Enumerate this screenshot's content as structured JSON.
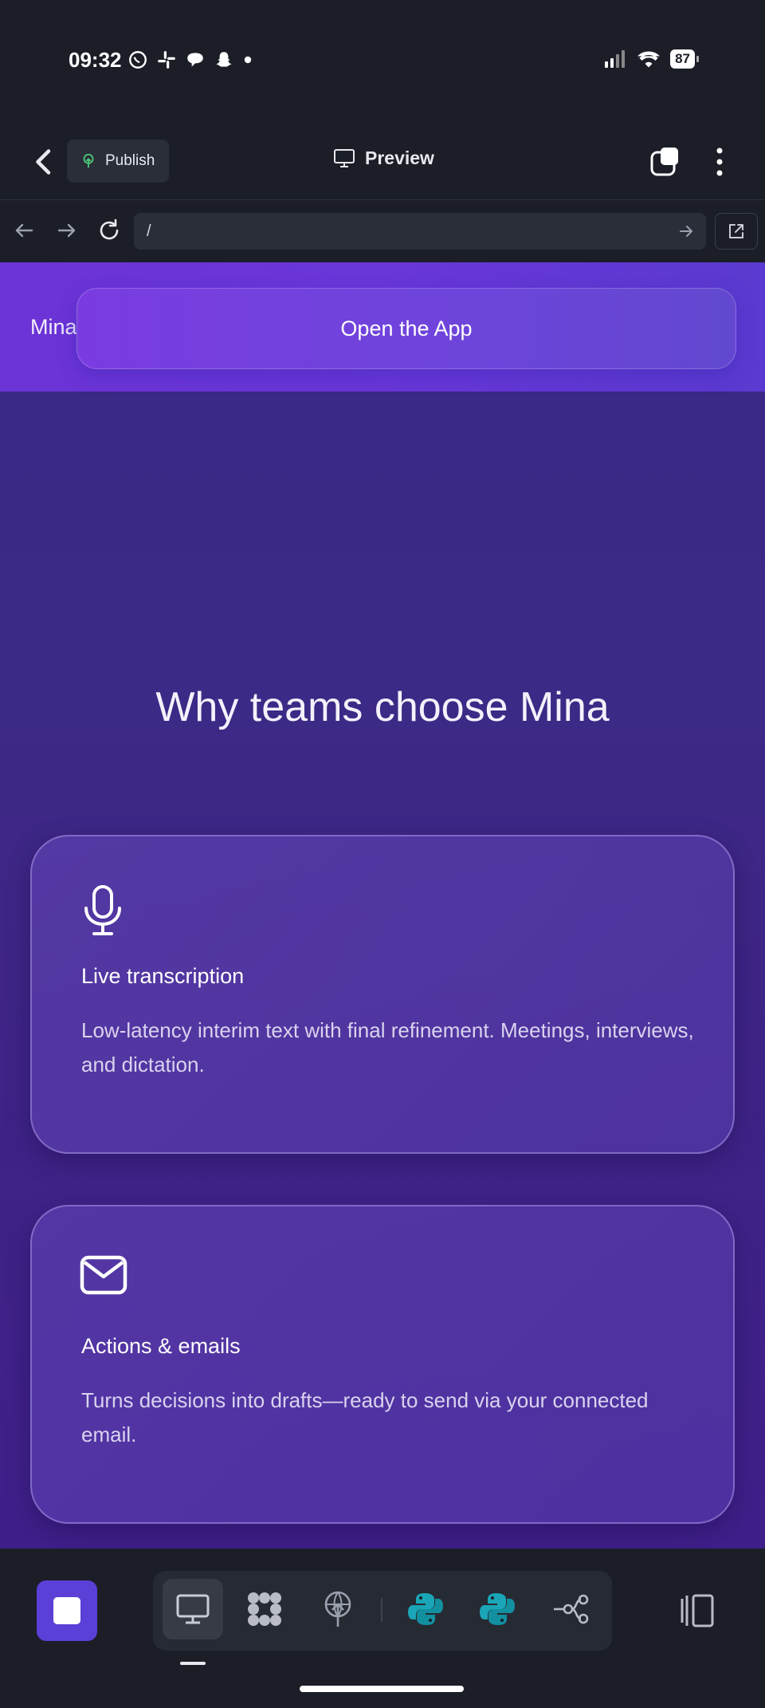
{
  "status_bar": {
    "time": "09:32",
    "battery": "87",
    "app_icons": [
      "whatsapp-icon",
      "slack-icon",
      "chat-icon",
      "snapchat-icon",
      "dot-icon"
    ]
  },
  "toolbar": {
    "publish_label": "Publish",
    "preview_label": "Preview"
  },
  "url_bar": {
    "value": "/"
  },
  "page": {
    "brand": "Mina",
    "cta_label": "Open the App",
    "section_title": "Why teams choose Mina",
    "features": [
      {
        "icon": "microphone-icon",
        "title": "Live transcription",
        "description": "Low-latency interim text with final refinement. Meetings, interviews, and dictation."
      },
      {
        "icon": "mail-icon",
        "title": "Actions & emails",
        "description": "Turns decisions into drafts—ready to send via your connected email."
      }
    ]
  },
  "bottom_bar": {
    "tools": [
      "desktop-icon",
      "extensions-icon",
      "deploy-icon",
      "python-icon",
      "python-icon",
      "git-branch-icon"
    ],
    "active_tool": "desktop-icon"
  },
  "colors": {
    "accent": "#5b3fd6",
    "header_purple": "#6c33d6",
    "page_purple": "#3d2a86",
    "dark_bg": "#1b1e27",
    "python_teal": "#1aa6b7"
  }
}
